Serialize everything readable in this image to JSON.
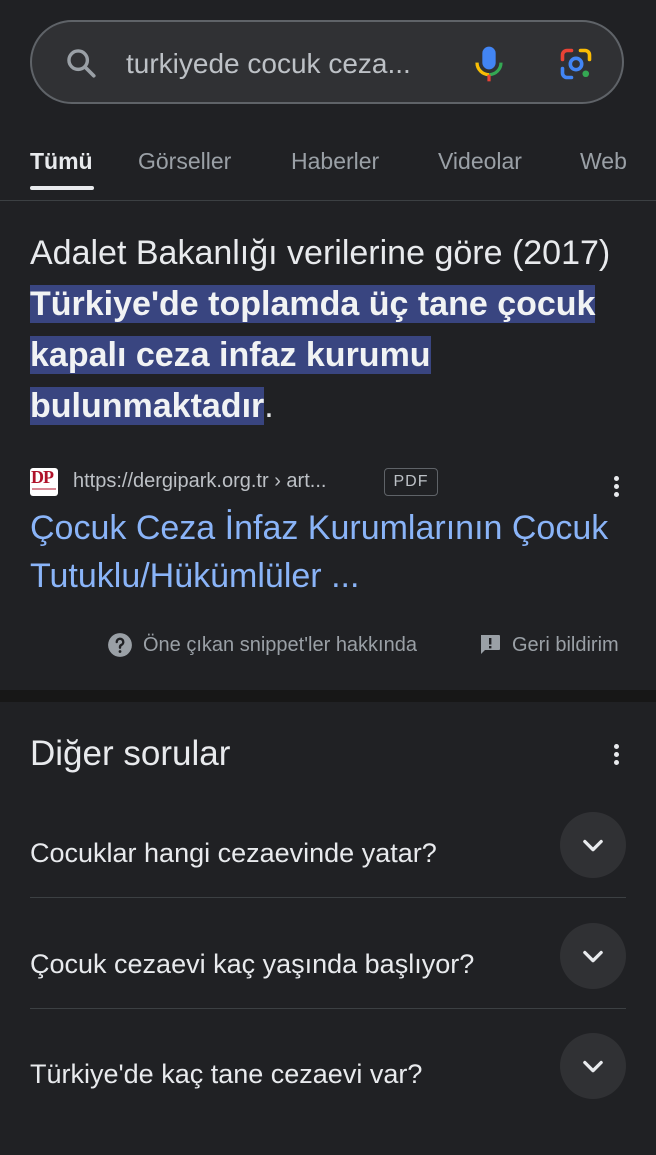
{
  "search": {
    "query": "turkiyede cocuk ceza..."
  },
  "tabs": [
    {
      "label": "Tümü",
      "active": true
    },
    {
      "label": "Görseller",
      "active": false
    },
    {
      "label": "Haberler",
      "active": false
    },
    {
      "label": "Videolar",
      "active": false
    },
    {
      "label": "Web",
      "active": false
    }
  ],
  "featured_snippet": {
    "text_plain_1": "Adalet Bakanlığı verilerine göre (2017) ",
    "text_highlight_1": "Türkiye'de toplamda üç tane çocuk kapalı ceza infaz kurumu bulunmaktadır",
    "text_plain_2": ".",
    "source": {
      "favicon_text": "DP",
      "url": "https://dergipark.org.tr › art...",
      "badge": "PDF"
    },
    "result_title": "Çocuk Ceza İnfaz Kurumlarının Çocuk Tutuklu/Hükümlüler ...",
    "footer": {
      "about_label": "Öne çıkan snippet'ler hakkında",
      "feedback_label": "Geri bildirim"
    }
  },
  "people_also_ask": {
    "title": "Diğer sorular",
    "questions": [
      "Cocuklar hangi cezaevinde yatar?",
      "Çocuk cezaevi kaç yaşında başlıyor?",
      "Türkiye'de kaç tane cezaevi var?"
    ]
  },
  "colors": {
    "background": "#202124",
    "highlight": "#394580",
    "link": "#8ab4f8",
    "text": "#e8eaed",
    "muted": "#9aa0a6"
  }
}
